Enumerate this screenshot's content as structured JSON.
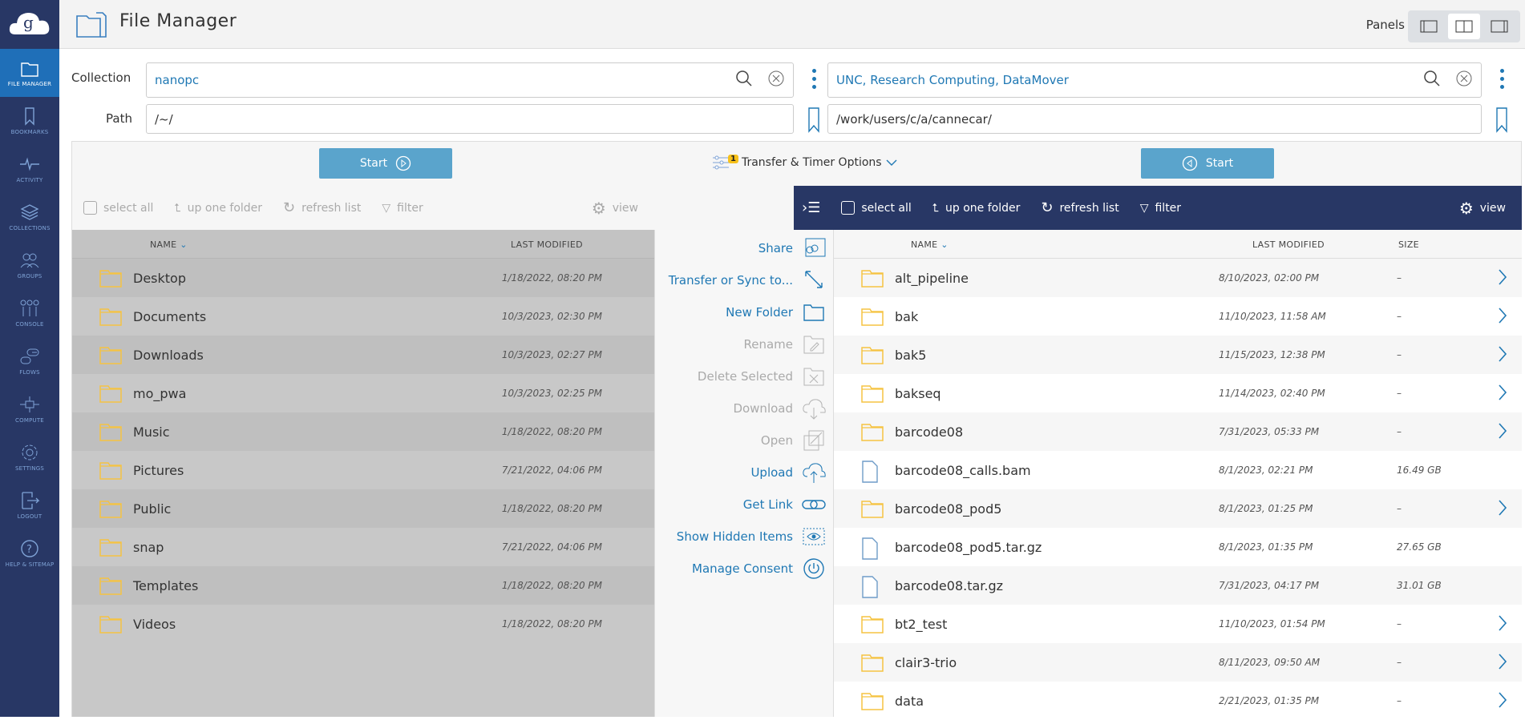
{
  "app": {
    "title": "File Manager",
    "panels_label": "Panels"
  },
  "sidebar": {
    "items": [
      {
        "label": "FILE MANAGER",
        "icon": "file-manager-icon",
        "active": true
      },
      {
        "label": "BOOKMARKS",
        "icon": "bookmark-icon"
      },
      {
        "label": "ACTIVITY",
        "icon": "activity-icon"
      },
      {
        "label": "COLLECTIONS",
        "icon": "collections-icon"
      },
      {
        "label": "GROUPS",
        "icon": "groups-icon"
      },
      {
        "label": "CONSOLE",
        "icon": "console-icon"
      },
      {
        "label": "FLOWS",
        "icon": "flows-icon"
      },
      {
        "label": "COMPUTE",
        "icon": "compute-icon"
      },
      {
        "label": "SETTINGS",
        "icon": "gear-icon"
      },
      {
        "label": "LOGOUT",
        "icon": "logout-icon"
      },
      {
        "label": "HELP & SITEMAP",
        "icon": "help-icon"
      }
    ]
  },
  "form": {
    "collection_label": "Collection",
    "path_label": "Path",
    "left_collection": "nanopc",
    "left_path": "/~/",
    "right_collection": "UNC, Research Computing, DataMover",
    "right_path": "/work/users/c/a/cannecar/"
  },
  "transfer": {
    "start_label": "Start",
    "options_label": "Transfer & Timer Options",
    "options_badge": "1"
  },
  "toolbar": {
    "select_all": "select all",
    "up_one_folder": "up one folder",
    "refresh_list": "refresh list",
    "filter": "filter",
    "view": "view"
  },
  "columns": {
    "name": "NAME",
    "last_modified": "LAST MODIFIED",
    "size": "SIZE"
  },
  "left_files": [
    {
      "name": "Desktop",
      "modified": "1/18/2022, 08:20 PM"
    },
    {
      "name": "Documents",
      "modified": "10/3/2023, 02:30 PM"
    },
    {
      "name": "Downloads",
      "modified": "10/3/2023, 02:27 PM"
    },
    {
      "name": "mo_pwa",
      "modified": "10/3/2023, 02:25 PM"
    },
    {
      "name": "Music",
      "modified": "1/18/2022, 08:20 PM"
    },
    {
      "name": "Pictures",
      "modified": "7/21/2022, 04:06 PM"
    },
    {
      "name": "Public",
      "modified": "1/18/2022, 08:20 PM"
    },
    {
      "name": "snap",
      "modified": "7/21/2022, 04:06 PM"
    },
    {
      "name": "Templates",
      "modified": "1/18/2022, 08:20 PM"
    },
    {
      "name": "Videos",
      "modified": "1/18/2022, 08:20 PM"
    }
  ],
  "menu": [
    {
      "label": "Share",
      "enabled": true,
      "icon": "share-icon"
    },
    {
      "label": "Transfer or Sync to...",
      "enabled": true,
      "icon": "transfer-arrows-icon"
    },
    {
      "label": "New Folder",
      "enabled": true,
      "icon": "new-folder-icon"
    },
    {
      "label": "Rename",
      "enabled": false,
      "icon": "rename-icon"
    },
    {
      "label": "Delete Selected",
      "enabled": false,
      "icon": "delete-icon"
    },
    {
      "label": "Download",
      "enabled": false,
      "icon": "download-icon"
    },
    {
      "label": "Open",
      "enabled": false,
      "icon": "open-icon"
    },
    {
      "label": "Upload",
      "enabled": true,
      "icon": "upload-icon"
    },
    {
      "label": "Get Link",
      "enabled": true,
      "icon": "link-icon"
    },
    {
      "label": "Show Hidden Items",
      "enabled": true,
      "icon": "eye-icon"
    },
    {
      "label": "Manage Consent",
      "enabled": true,
      "icon": "power-icon"
    }
  ],
  "right_files": [
    {
      "name": "alt_pipeline",
      "modified": "8/10/2023, 02:00 PM",
      "size": "–",
      "type": "folder"
    },
    {
      "name": "bak",
      "modified": "11/10/2023, 11:58 AM",
      "size": "–",
      "type": "folder"
    },
    {
      "name": "bak5",
      "modified": "11/15/2023, 12:38 PM",
      "size": "–",
      "type": "folder"
    },
    {
      "name": "bakseq",
      "modified": "11/14/2023, 02:40 PM",
      "size": "–",
      "type": "folder"
    },
    {
      "name": "barcode08",
      "modified": "7/31/2023, 05:33 PM",
      "size": "–",
      "type": "folder"
    },
    {
      "name": "barcode08_calls.bam",
      "modified": "8/1/2023, 02:21 PM",
      "size": "16.49 GB",
      "type": "file"
    },
    {
      "name": "barcode08_pod5",
      "modified": "8/1/2023, 01:25 PM",
      "size": "–",
      "type": "folder"
    },
    {
      "name": "barcode08_pod5.tar.gz",
      "modified": "8/1/2023, 01:35 PM",
      "size": "27.65 GB",
      "type": "file"
    },
    {
      "name": "barcode08.tar.gz",
      "modified": "7/31/2023, 04:17 PM",
      "size": "31.01 GB",
      "type": "file"
    },
    {
      "name": "bt2_test",
      "modified": "11/10/2023, 01:54 PM",
      "size": "–",
      "type": "folder"
    },
    {
      "name": "clair3-trio",
      "modified": "8/11/2023, 09:50 AM",
      "size": "–",
      "type": "folder"
    },
    {
      "name": "data",
      "modified": "2/21/2023, 01:35 PM",
      "size": "–",
      "type": "folder"
    }
  ],
  "colors": {
    "sidebar": "#283765",
    "active_nav": "#1f6fb8",
    "accent": "#1f78b4",
    "start_button": "#5aa4cc",
    "folder": "#f5c342",
    "badge": "#f7c11a"
  }
}
